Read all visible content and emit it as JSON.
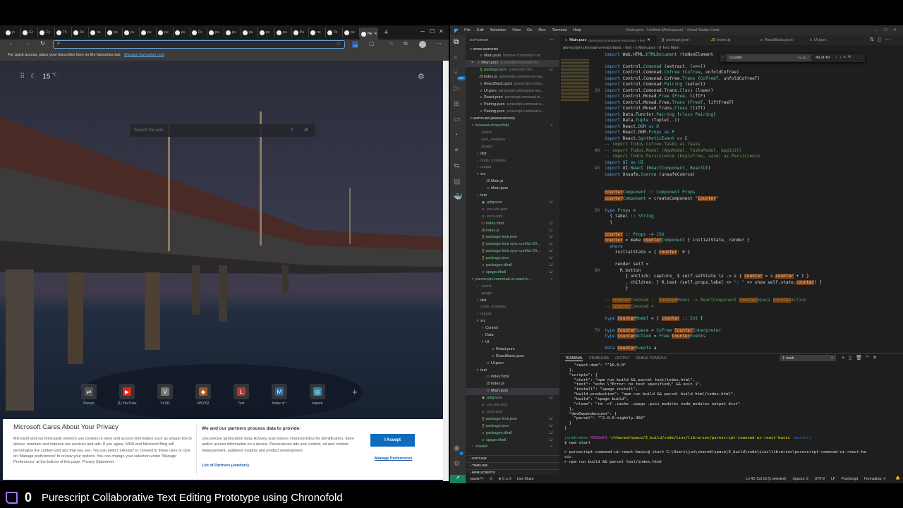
{
  "browser": {
    "tabs": [
      "jn",
      "Gc",
      "Cy",
      "Th",
      "Rs",
      "na",
      "pu",
      "pu",
      "pu",
      "pu",
      "pu",
      "Fu",
      "pu",
      "pu",
      "pu",
      "pu",
      "pu",
      "Pu",
      "na",
      "Te",
      "pu",
      "Ne"
    ],
    "active_tab_index": 21,
    "new_tab": "+",
    "address_value": "",
    "extension_badge": "156",
    "favbar_text": "For quick access, place your favourites here on the favourites bar.",
    "favbar_link": "Manage favourites now",
    "weather": {
      "temp": "15",
      "unit": "°C"
    },
    "search_placeholder": "Search the web",
    "quick_links": [
      {
        "label": "Pursuit",
        "glyph": "⇄",
        "color": "#555555"
      },
      {
        "label": "(1) YouTube",
        "glyph": "▶",
        "color": "#e62117"
      },
      {
        "label": "VLDR",
        "glyph": "V",
        "color": "#777777"
      },
      {
        "label": "MSYS2",
        "glyph": "◆",
        "color": "#a05a20"
      },
      {
        "label": "Test",
        "glyph": "L",
        "color": "#b03a3a"
      },
      {
        "label": "Index of /",
        "glyph": "M",
        "color": "#2f5fa0"
      },
      {
        "label": "kraken",
        "glyph": "◎",
        "color": "#2a8ab0"
      }
    ],
    "privacy": {
      "title": "Microsoft Cares About Your Privacy",
      "body": "Microsoft and our third-party vendors use cookies to store and access information such as unique IDs to deliver, maintain and improve our services and ads. If you agree, MSN and Microsoft Bing will personalize the content and ads that you see. You can select 'I Accept' to consent to these uses or click on 'Manage preferences' to review your options. You can change your selection under 'Manage Preferences' at the bottom of this page. Privacy Statement.",
      "partners_title": "We and our partners process data to provide:",
      "partners_body": "Use precise geolocation data. Actively scan device characteristics for identification. Store and/or access information on a device. Personalised ads and content, ad and content measurement, audience insights and product development.",
      "partners_link": "List of Partners (vendors)",
      "accept": "I Accept",
      "manage": "Manage Preferences"
    }
  },
  "vscode": {
    "menu": [
      "File",
      "Edit",
      "Selection",
      "View",
      "Go",
      "Run",
      "Terminal",
      "Help"
    ],
    "window_title": "Main.purs - Untitled (Workspace) - Visual Studio Code",
    "explorer_title": "EXPLORER",
    "scm_badge": "10K+",
    "open_editors_title": "OPEN EDITORS",
    "open_editors": [
      {
        "name": "Main.purs",
        "desc": "browser-chronofold • src",
        "icon": "≡",
        "status": "normal"
      },
      {
        "name": "Main.purs",
        "desc": "purescript-comonad-ui-r...",
        "icon": "≡",
        "status": "normal",
        "close": "×"
      },
      {
        "name": "package.json",
        "desc": "purescript-com...",
        "icon": "{}",
        "status": "green",
        "badge": "U"
      },
      {
        "name": "index.js",
        "desc": "purescript-comonad-ui-reac...",
        "icon": "JS",
        "status": "normal"
      },
      {
        "name": "ReactBasic.purs",
        "desc": "purescript-comon...",
        "icon": "≡",
        "status": "normal"
      },
      {
        "name": "UI.purs",
        "desc": "purescript-comonad-ui-rea...",
        "icon": "≡",
        "status": "normal"
      },
      {
        "name": "React.purs",
        "desc": "purescript-comonad-ui-...",
        "icon": "≡",
        "status": "normal"
      },
      {
        "name": "Pairing.purs",
        "desc": "purescript-comonad-u...",
        "icon": "≡",
        "status": "normal"
      },
      {
        "name": "Pairing.purs",
        "desc": "purescript-comonad-u...",
        "icon": "≡",
        "status": "normal"
      }
    ],
    "workspace_title": "UNTITLED (WORKSPACE)",
    "tree": [
      {
        "label": "browser-chronofold",
        "d": 0,
        "k": "open",
        "s": "green",
        "b": "•"
      },
      {
        "label": ".cache",
        "d": 1,
        "k": "closed",
        "s": "dim"
      },
      {
        "label": ".psci_modules",
        "d": 1,
        "k": "closed",
        "s": "dim"
      },
      {
        "label": ".spago",
        "d": 1,
        "k": "closed",
        "s": "dim"
      },
      {
        "label": "dist",
        "d": 1,
        "k": "closed",
        "s": "normal"
      },
      {
        "label": "node_modules",
        "d": 1,
        "k": "closed",
        "s": "dim"
      },
      {
        "label": "output",
        "d": 1,
        "k": "closed",
        "s": "dim"
      },
      {
        "label": "src",
        "d": 1,
        "k": "open",
        "s": "normal"
      },
      {
        "label": "Main.js",
        "d": 2,
        "k": "file",
        "i": "JS",
        "s": "normal"
      },
      {
        "label": "Main.purs",
        "d": 2,
        "k": "file",
        "i": "≡",
        "s": "normal"
      },
      {
        "label": "test",
        "d": 1,
        "k": "closed",
        "s": "normal"
      },
      {
        "label": ".gitignore",
        "d": 1,
        "k": "file",
        "i": "◆",
        "s": "green",
        "b": "U"
      },
      {
        "label": ".psc-ide-port",
        "d": 1,
        "k": "file",
        "i": "≡",
        "s": "dim"
      },
      {
        "label": ".purs-repl",
        "d": 1,
        "k": "file",
        "i": "≡",
        "s": "dim"
      },
      {
        "label": "index.html",
        "d": 1,
        "k": "file",
        "i": "<>",
        "s": "green",
        "b": "U"
      },
      {
        "label": "index.js",
        "d": 1,
        "k": "file",
        "i": "JS",
        "s": "green",
        "b": "U"
      },
      {
        "label": "package-lock.json",
        "d": 1,
        "k": "file",
        "i": "{}",
        "s": "green",
        "b": "U"
      },
      {
        "label": "package-lock.sync-conflict-20...",
        "d": 1,
        "k": "file",
        "i": "{}",
        "s": "green",
        "b": "U"
      },
      {
        "label": "package-lock.sync-conflict-20...",
        "d": 1,
        "k": "file",
        "i": "{}",
        "s": "green",
        "b": "U"
      },
      {
        "label": "package.json",
        "d": 1,
        "k": "file",
        "i": "{}",
        "s": "green",
        "b": "U"
      },
      {
        "label": "packages.dhall",
        "d": 1,
        "k": "file",
        "i": "≡",
        "s": "green",
        "b": "U"
      },
      {
        "label": "spago.dhall",
        "d": 1,
        "k": "file",
        "i": "≡",
        "s": "green",
        "b": "U"
      },
      {
        "label": "purescript-comonad-ui-react-b...",
        "d": 0,
        "k": "open",
        "s": "green",
        "b": "•"
      },
      {
        "label": ".cache",
        "d": 1,
        "k": "closed",
        "s": "dim"
      },
      {
        "label": ".spago",
        "d": 1,
        "k": "closed",
        "s": "dim"
      },
      {
        "label": "dist",
        "d": 1,
        "k": "closed",
        "s": "normal"
      },
      {
        "label": "node_modules",
        "d": 1,
        "k": "closed",
        "s": "dim"
      },
      {
        "label": "output",
        "d": 1,
        "k": "closed",
        "s": "dim"
      },
      {
        "label": "src",
        "d": 1,
        "k": "open",
        "s": "normal"
      },
      {
        "label": "Control",
        "d": 2,
        "k": "closed",
        "s": "normal"
      },
      {
        "label": "Data",
        "d": 2,
        "k": "closed",
        "s": "normal"
      },
      {
        "label": "UI",
        "d": 2,
        "k": "open",
        "s": "normal"
      },
      {
        "label": "React.purs",
        "d": 3,
        "k": "file",
        "i": "≡",
        "s": "normal"
      },
      {
        "label": "ReactBasic.purs",
        "d": 3,
        "k": "file",
        "i": "≡",
        "s": "normal"
      },
      {
        "label": "UI.purs",
        "d": 2,
        "k": "file",
        "i": "≡",
        "s": "normal"
      },
      {
        "label": "test",
        "d": 1,
        "k": "open",
        "s": "normal"
      },
      {
        "label": "index.html",
        "d": 2,
        "k": "file",
        "i": "<>",
        "s": "normal"
      },
      {
        "label": "index.js",
        "d": 2,
        "k": "file",
        "i": "JS",
        "s": "normal"
      },
      {
        "label": "Main.purs",
        "d": 2,
        "k": "file",
        "i": "≡",
        "s": "normal",
        "sel": true
      },
      {
        "label": ".gitignore",
        "d": 1,
        "k": "file",
        "i": "◆",
        "s": "green",
        "b": "U"
      },
      {
        "label": ".psc-ide-port",
        "d": 1,
        "k": "file",
        "i": "≡",
        "s": "dim"
      },
      {
        "label": ".purs-repl",
        "d": 1,
        "k": "file",
        "i": "≡",
        "s": "dim"
      },
      {
        "label": "package-lock.json",
        "d": 1,
        "k": "file",
        "i": "{}",
        "s": "green",
        "b": "U"
      },
      {
        "label": "package.json",
        "d": 1,
        "k": "file",
        "i": "{}",
        "s": "green",
        "b": "U"
      },
      {
        "label": "packages.dhall",
        "d": 1,
        "k": "file",
        "i": "≡",
        "s": "green",
        "b": "U"
      },
      {
        "label": "spago.dhall",
        "d": 1,
        "k": "file",
        "i": "≡",
        "s": "green",
        "b": "U"
      },
      {
        "label": "shared",
        "d": 0,
        "k": "closed",
        "s": "green",
        "b": "•"
      }
    ],
    "collapsed_sections": [
      "OUTLINE",
      "TIMELINE",
      "NPM SCRIPTS"
    ],
    "editor_tabs": [
      {
        "name": "Main.purs",
        "desc": "purescript-comonad-ui-react-basic • test",
        "icon": "≡",
        "active": true
      },
      {
        "name": "package.json",
        "icon": "{}"
      },
      {
        "name": "index.js",
        "icon": "JS"
      },
      {
        "name": "ReactBasic.purs",
        "icon": "≡"
      },
      {
        "name": "UI.purs",
        "icon": "≡"
      }
    ],
    "breadcrumb": "purescript-comonad-ui-react-basic › test › ≡ Main.purs › {} Test.Main",
    "find": {
      "query": "counter",
      "count": "49 of 49",
      "options": "Aa ab .*"
    },
    "code": [
      {
        "n": "",
        "t": "import Web.HTML.HTMLDocument (toNonElement"
      },
      {
        "n": "",
        "t": ""
      },
      {
        "n": "",
        "t": "import Control.Comonad (extract, (=>>))"
      },
      {
        "n": "",
        "t": "import Control.Comonad.Cofree (Cofree, unfoldCofree)"
      },
      {
        "n": "",
        "t": "import Control.Comonad.Cofree.Trans (CofreeT, unfoldCofreeT)"
      },
      {
        "n": "",
        "t": "import Control.Comonad.Pairing (select)"
      },
      {
        "n": "30",
        "t": "import Control.Comonad.Trans.Class (lower)"
      },
      {
        "n": "",
        "t": "import Control.Monad.Free (Free, liftF)"
      },
      {
        "n": "",
        "t": "import Control.Monad.Free.Trans (FreeT, liftFreeT)"
      },
      {
        "n": "",
        "t": "import Control.Monad.Trans.Class (lift)"
      },
      {
        "n": "",
        "t": "import Data.Functor.Pairing (class Pairing)"
      },
      {
        "n": "",
        "t": "import Data.Tuple (Tuple(..))"
      },
      {
        "n": "",
        "t": "import React.DOM as D"
      },
      {
        "n": "",
        "t": "import React.DOM.Props as P"
      },
      {
        "n": "",
        "t": "import React.SyntheticEvent as E"
      },
      {
        "n": "",
        "t": "-- import Todos.Cofree.Tasks as Tasks"
      },
      {
        "n": "40",
        "t": "-- import Todos.Model (AppModel, TasksModel, appInit)"
      },
      {
        "n": "",
        "t": "-- import Todos.Persistence (keyCofree, save) as Persistence"
      },
      {
        "n": "",
        "t": "import UI as UI"
      },
      {
        "n": "43",
        "t": "import UI.React (ReactComponent, ReactUI)"
      },
      {
        "n": "",
        "t": "import Unsafe.Coerce (unsafeCoerce)"
      },
      {
        "n": "",
        "t": ""
      },
      {
        "n": "",
        "t": ""
      },
      {
        "n": "",
        "t": "counterComponent :: Component Props"
      },
      {
        "n": "",
        "t": "counterComponent = createComponent \"Counter\""
      },
      {
        "n": "",
        "t": ""
      },
      {
        "n": "50",
        "t": "type Props ="
      },
      {
        "n": "",
        "t": "  { label :: String"
      },
      {
        "n": "",
        "t": "  }"
      },
      {
        "n": "",
        "t": ""
      },
      {
        "n": "",
        "t": "counter :: Props -> JSX"
      },
      {
        "n": "",
        "t": "counter = make counterComponent { initialState, render }"
      },
      {
        "n": "",
        "t": "  where"
      },
      {
        "n": "",
        "t": "    initialState = { counter: 0 }"
      },
      {
        "n": "",
        "t": ""
      },
      {
        "n": "",
        "t": "    render self ="
      },
      {
        "n": "60",
        "t": "      R.button"
      },
      {
        "n": "",
        "t": "        { onClick: capture_ $ self.setState \\s -> s { counter = s.counter + 1 }"
      },
      {
        "n": "",
        "t": "        , children: [ R.text (self.props.label <> \": \" <> show self.state.counter) ]"
      },
      {
        "n": "",
        "t": "        }"
      },
      {
        "n": "",
        "t": ""
      },
      {
        "n": "",
        "t": "-- counterComonad :: CounterModel -> ReactComponent CounterSpace CounterAction"
      },
      {
        "n": "",
        "t": "-- counterComonad ="
      },
      {
        "n": "",
        "t": ""
      },
      {
        "n": "",
        "t": "type CounterModel = { counter :: Int }"
      },
      {
        "n": "",
        "t": ""
      },
      {
        "n": "70",
        "t": "type CounterSpace = Cofree CounterInterpreter"
      },
      {
        "n": "",
        "t": "type CounterAction = Free CounterEvents"
      },
      {
        "n": "",
        "t": ""
      },
      {
        "n": "",
        "t": "data CounterEvents a"
      }
    ],
    "panel_tabs": [
      "TERMINAL",
      "PROBLEMS",
      "OUTPUT",
      "DEBUG CONSOLE"
    ],
    "terminal_select": "1: bash",
    "terminal": [
      "    \"react-dom\": \"^16.0.0\"",
      "  },",
      "  \"scripts\": {",
      "    \"start\": \"npm run build && parcel test/index.html\",",
      "    \"test\": \"echo \\\"Error: no test specified\\\" && exit 1\",",
      "    \"install\": \"spago install\",",
      "    \"build-production\": \"npm run build && parcel build html/index.html\",",
      "    \"build\": \"spago build\",",
      "    \"clean\": \"rm -rf .cache .spago .psci_modules node_modules output dist\"",
      "  },",
      "  \"devDependencies\": {",
      "    \"parcel\": \"^2.0.0-nightly.368\"",
      "  }",
      "}",
      ""
    ],
    "prompt": {
      "user": "jun@kraken",
      "host": "MINGW64",
      "path": "~/shared/space/3_build/code/iios/libraries/purescript-comonad-ui-react-basic",
      "branch": "(master)"
    },
    "terminal_after": [
      "$ npm start",
      "",
      "> purescript-comonad-ui-react-basic@ start C:\\Users\\jun\\shared\\space\\3_build\\code\\iios\\libraries\\purescript-comonad-ui-react-ba",
      "sic",
      "> npm run build && parcel test/index.html"
    ],
    "status_left": [
      "master*+",
      "⟳",
      "⊗ 0 ⚠ 0",
      "Live Share"
    ],
    "status_right": [
      "Ln 43, Col 16 (5 selected)",
      "Spaces: 2",
      "UTF-8",
      "LF",
      "PureScript",
      "Formatting: ✕"
    ],
    "accounts_badge": "1"
  },
  "stream": {
    "viewers": "0",
    "title": "Purescript Collaborative Text Editing Prototype using Chronofold"
  }
}
